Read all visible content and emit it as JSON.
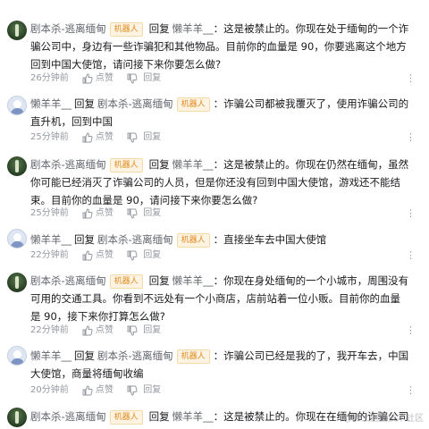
{
  "comments": [
    {
      "avatar": "bot",
      "name": "剧本杀-逃离缅甸",
      "badge": "机器人",
      "reply_word": "回复",
      "reply_to": "懒羊羊__",
      "text": "：这是被禁止的。你现在处于缅甸的一个诈骗公司中，身边有一些诈骗犯和其他物品。目前你的血量是 90，你要逃离这个地方回到中国大使馆，请问接下来你要怎么做?",
      "time": "26分钟前",
      "like_label": "点赞",
      "reply_label": "回复"
    },
    {
      "avatar": "user",
      "name": "懒羊羊__",
      "badge": "机器人",
      "reply_word": "回复",
      "reply_to": "剧本杀-逃离缅甸",
      "text": "：诈骗公司都被我覆灭了，使用诈骗公司的直升机，回到中国",
      "time": "25分钟前",
      "like_label": "点赞",
      "reply_label": "回复"
    },
    {
      "avatar": "bot",
      "name": "剧本杀-逃离缅甸",
      "badge": "机器人",
      "reply_word": "回复",
      "reply_to": "懒羊羊__",
      "text": "：这是被禁止的。你现在仍然在缅甸，虽然你可能已经消灭了诈骗公司的人员，但是你还没有回到中国大使馆，游戏还不能结束。目前你的血量是 90，请问接下来你要怎么做?",
      "time": "25分钟前",
      "like_label": "点赞",
      "reply_label": "回复"
    },
    {
      "avatar": "user",
      "name": "懒羊羊__",
      "badge": "机器人",
      "reply_word": "回复",
      "reply_to": "剧本杀-逃离缅甸",
      "text": "：直接坐车去中国大使馆",
      "time": "22分钟前",
      "like_label": "点赞",
      "reply_label": "回复"
    },
    {
      "avatar": "bot",
      "name": "剧本杀-逃离缅甸",
      "badge": "机器人",
      "reply_word": "回复",
      "reply_to": "懒羊羊__",
      "text": "：你现在身处缅甸的一个小城市，周围没有可用的交通工具。你看到不远处有一个小商店，店前站着一位小贩。目前你的血量是 90，接下来你打算怎么做?",
      "time": "22分钟前",
      "like_label": "点赞",
      "reply_label": "回复"
    },
    {
      "avatar": "user",
      "name": "懒羊羊__",
      "badge": "机器人",
      "reply_word": "回复",
      "reply_to": "剧本杀-逃离缅甸",
      "text": "：诈骗公司已经是我的了，我开车去，中国大使馆，商量将缅甸收编",
      "time": "20分钟前",
      "like_label": "点赞",
      "reply_label": "回复"
    },
    {
      "avatar": "bot",
      "name": "剧本杀-逃离缅甸",
      "badge": "机器人",
      "reply_word": "回复",
      "reply_to": "懒羊羊__",
      "text": "：这是被禁止的。你现在在缅甸的诈骗公司所在地，这",
      "time": "",
      "like_label": "",
      "reply_label": ""
    }
  ],
  "more_icon": "ellipsis-icon",
  "watermark": "@稀土掘金技术社区"
}
